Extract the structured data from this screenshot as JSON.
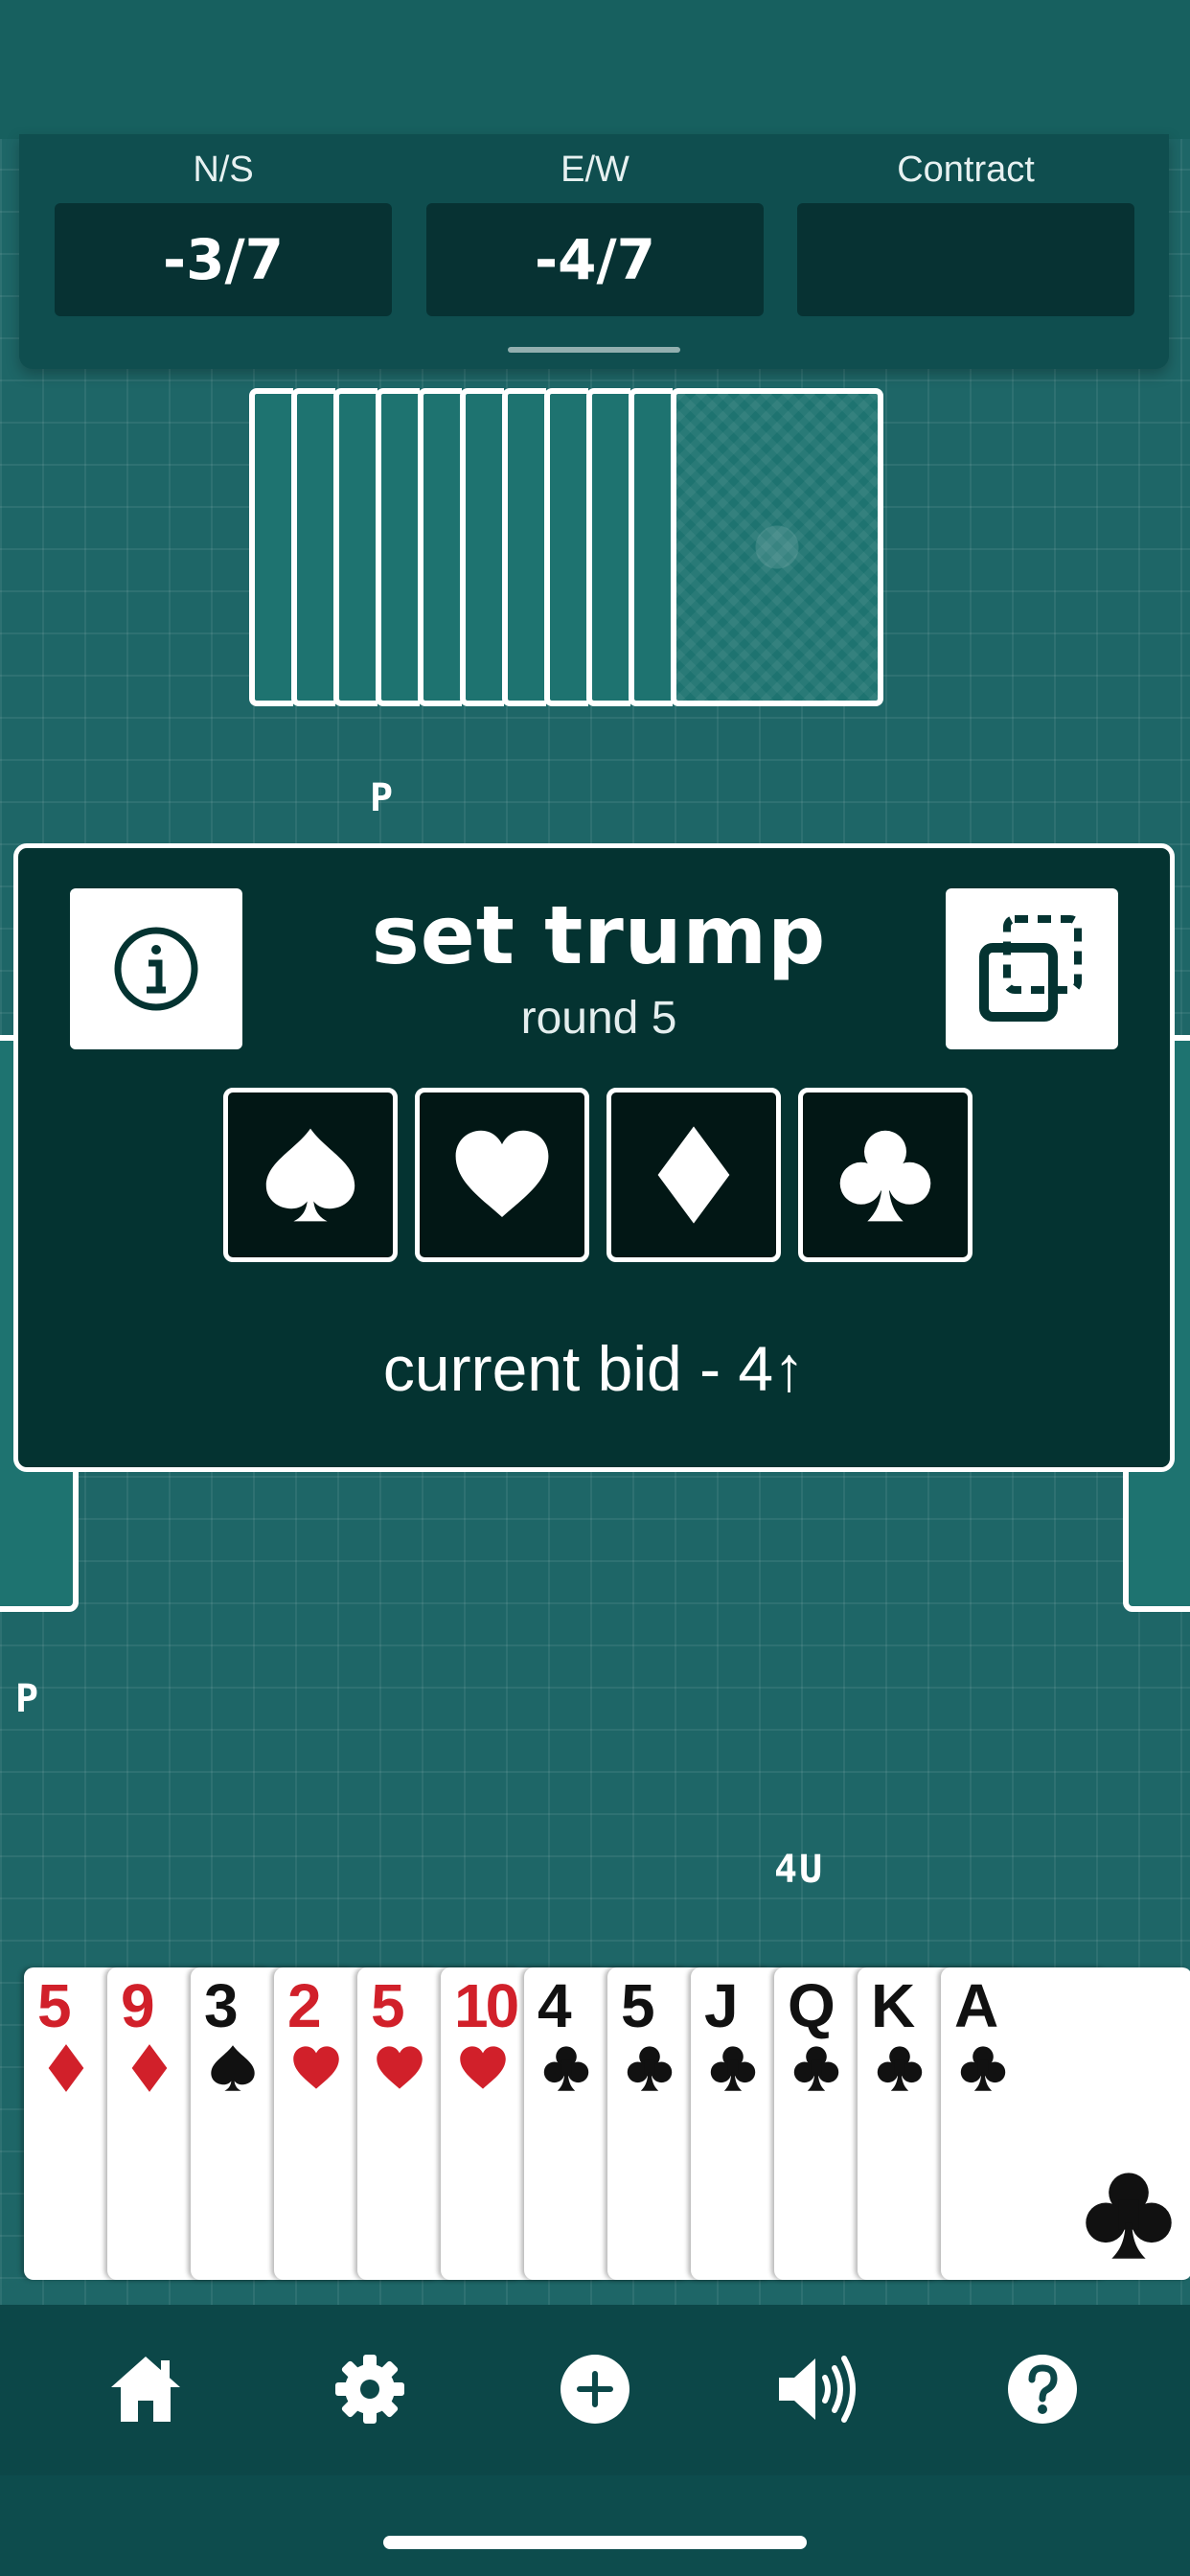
{
  "scoreboard": {
    "columns": [
      {
        "label": "N/S",
        "value": "-3/7"
      },
      {
        "label": "E/W",
        "value": "-4/7"
      },
      {
        "label": "Contract",
        "value": ""
      }
    ]
  },
  "table": {
    "north_bid": "P",
    "west_bid": "P",
    "south_bid": "4U",
    "north_cards_count": 11
  },
  "dialog": {
    "title": "set trump",
    "round": "round 5",
    "suits": [
      "spade-icon",
      "heart-icon",
      "diamond-icon",
      "club-icon"
    ],
    "current_bid": "current bid - 4↑"
  },
  "hand": {
    "cards": [
      {
        "rank": "5",
        "suit": "diamond",
        "color": "#d1202a"
      },
      {
        "rank": "9",
        "suit": "diamond",
        "color": "#d1202a"
      },
      {
        "rank": "3",
        "suit": "spade",
        "color": "#111111"
      },
      {
        "rank": "2",
        "suit": "heart",
        "color": "#d1202a"
      },
      {
        "rank": "5",
        "suit": "heart",
        "color": "#d1202a"
      },
      {
        "rank": "10",
        "suit": "heart",
        "color": "#d1202a"
      },
      {
        "rank": "4",
        "suit": "club",
        "color": "#111111"
      },
      {
        "rank": "5",
        "suit": "club",
        "color": "#111111"
      },
      {
        "rank": "J",
        "suit": "club",
        "color": "#111111"
      },
      {
        "rank": "Q",
        "suit": "club",
        "color": "#111111"
      },
      {
        "rank": "K",
        "suit": "club",
        "color": "#111111"
      },
      {
        "rank": "A",
        "suit": "club",
        "color": "#111111"
      }
    ]
  },
  "nav": {
    "items": [
      "home-icon",
      "settings-icon",
      "add-icon",
      "sound-icon",
      "help-icon"
    ]
  },
  "colors": {
    "table": "#1e6667",
    "panel": "#0f4e4f",
    "dialog": "#043331",
    "red_suit": "#d1202a"
  }
}
